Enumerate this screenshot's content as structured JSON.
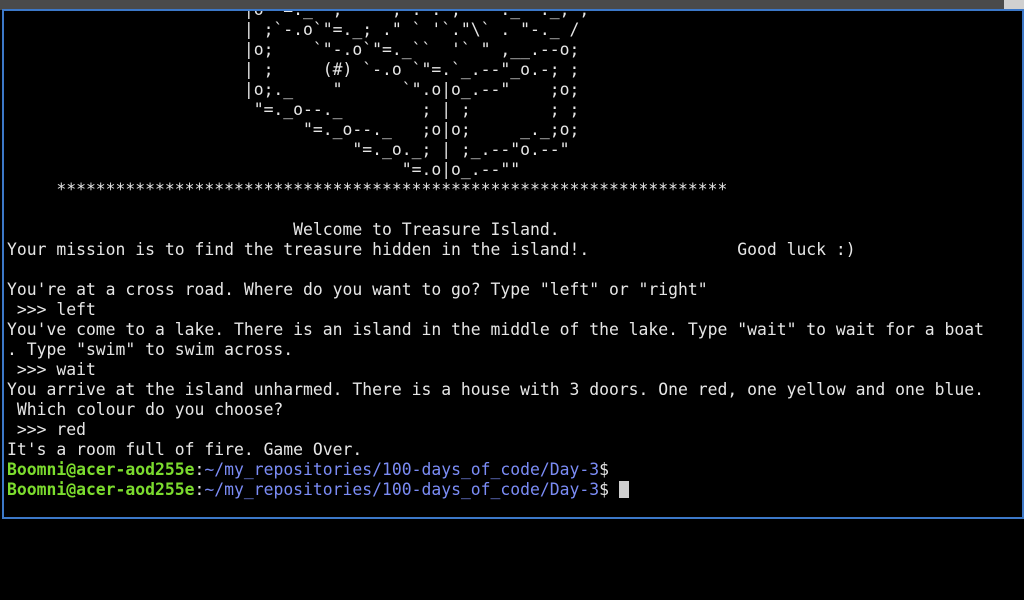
{
  "terminal": {
    "ascii_art": [
      "                        |o`\"=._` , \"` `; .\". ,  \"-._\"-._; ;",
      "                        | ;`-.o`\"=._; .\" ` '`.\"\\` . \"-._ /",
      "                        |o;    `\"-.o`\"=._``  '` \" ,__.--o;",
      "                        | ;     (#) `-.o `\"=.`_.--\"_o.-; ;",
      "                        |o;._    \"      `\".o|o_.--\"    ;o;",
      "                         \"=._o--._        ; | ;        ; ;",
      "                              \"=._o--._   ;o|o;     _._;o;",
      "                                   \"=._o._; | ;_.--\"o.--\"",
      "                                        \"=.o|o_.--\"\"",
      "     ********************************************************************"
    ],
    "welcome": "                             Welcome to Treasure Island.",
    "mission": "Your mission is to find the treasure hidden in the island!.               Good luck :)",
    "q1": "You're at a cross road. Where do you want to go? Type \"left\" or \"right\"",
    "a1": " >>> left",
    "q2_line1": "You've come to a lake. There is an island in the middle of the lake. Type \"wait\" to wait for a boat",
    "q2_line2": ". Type \"swim\" to swim across.",
    "a2": " >>> wait",
    "q3_line1": "You arrive at the island unharmed. There is a house with 3 doors. One red, one yellow and one blue.",
    "q3_line2": " Which colour do you choose?",
    "a3": " >>> red",
    "result": "It's a room full of fire. Game Over.",
    "prompt": {
      "user_host": "Boomni@acer-aod255e",
      "separator": ":",
      "path": "~/my_repositories/100-days_of_code/Day-3",
      "dollar": "$"
    }
  },
  "colors": {
    "background": "#000000",
    "text": "#e6e6e6",
    "prompt_user": "#7cdc2e",
    "prompt_path": "#7b8cf5",
    "window_border": "#3c78c8"
  }
}
